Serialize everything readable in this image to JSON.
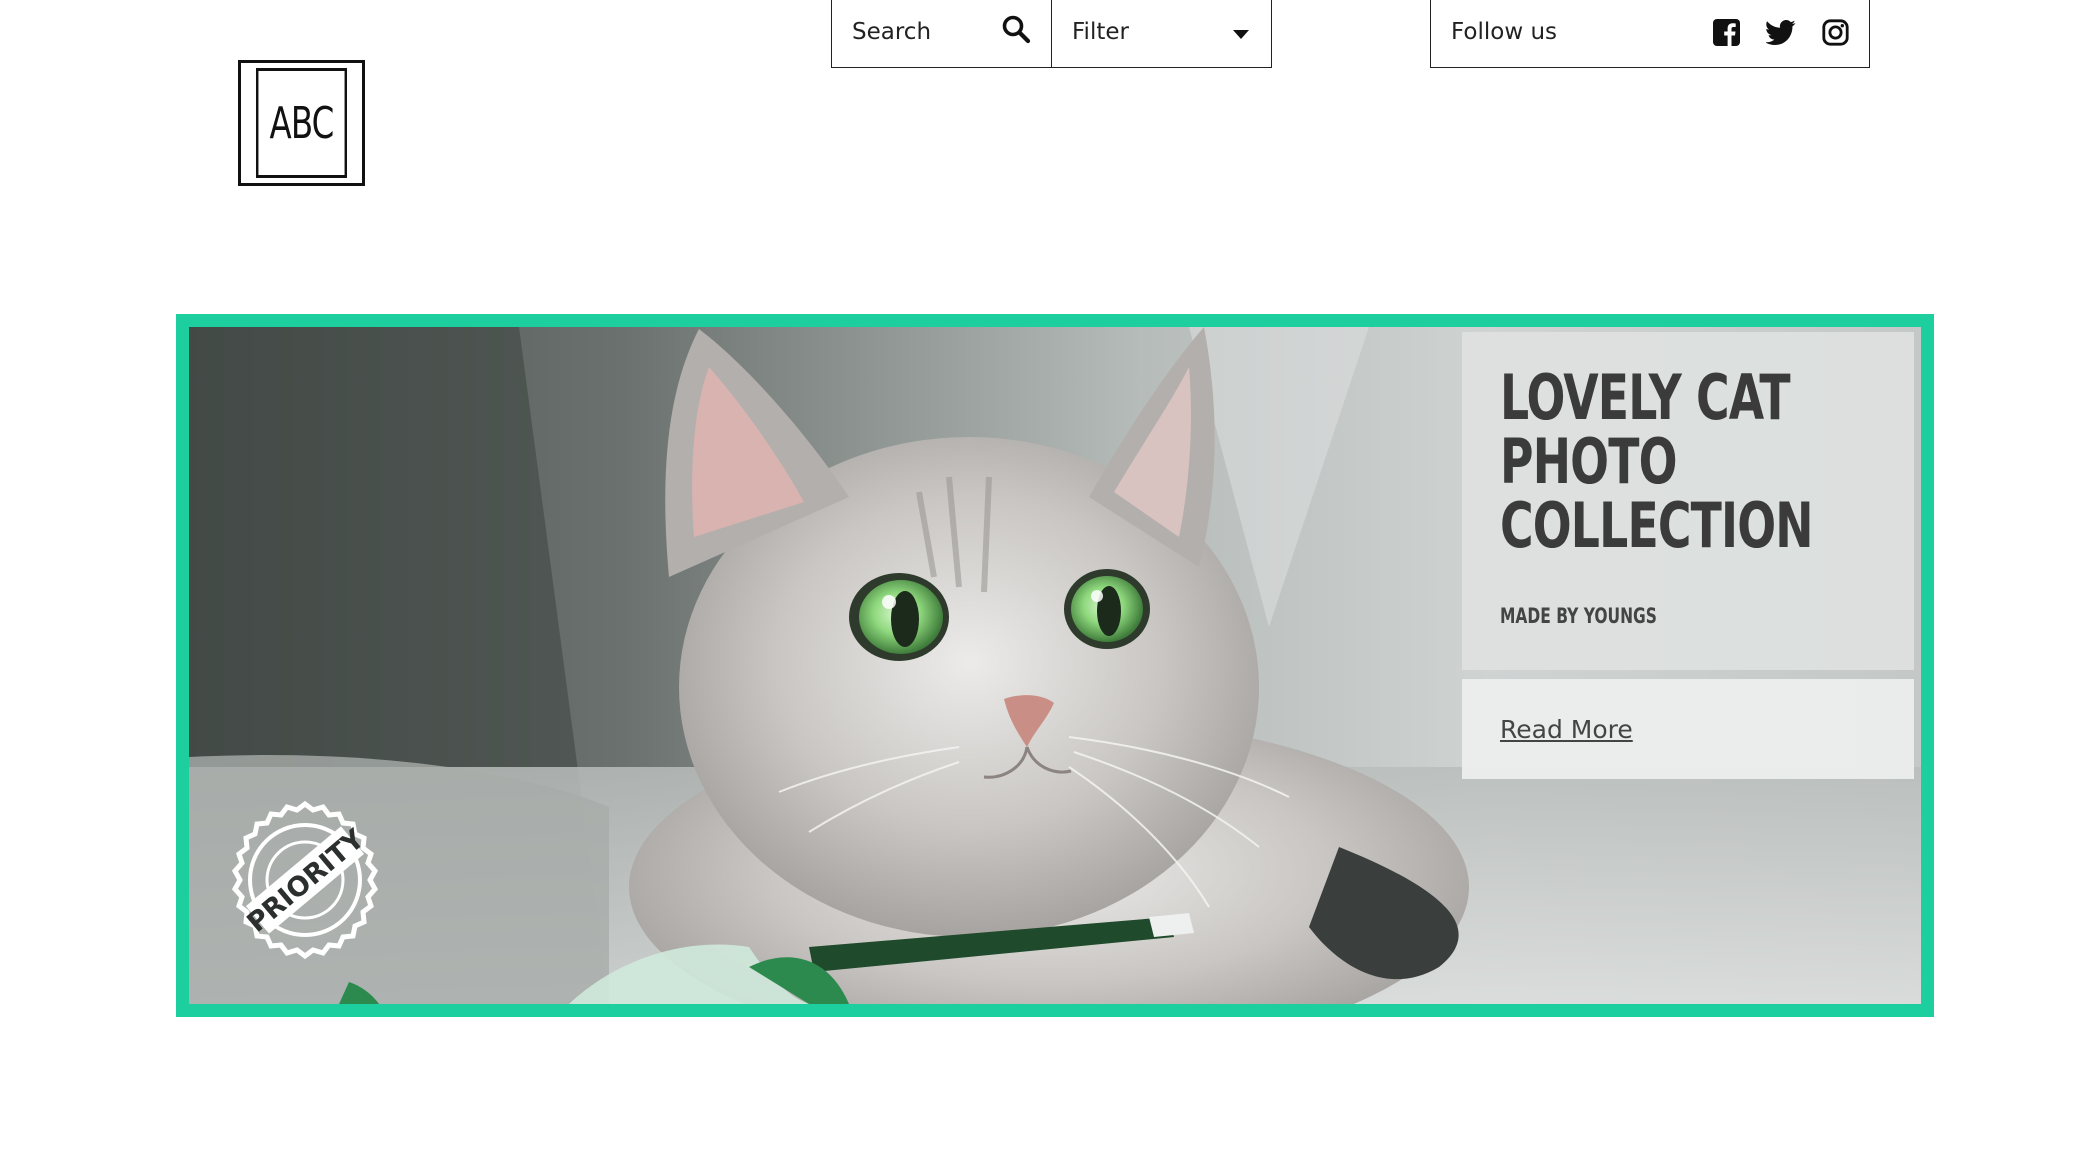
{
  "logo": {
    "text": "ABC"
  },
  "search": {
    "label": "Search",
    "icon": "search-icon"
  },
  "filter": {
    "label": "Filter",
    "icon": "caret-down-icon"
  },
  "follow": {
    "label": "Follow us",
    "icons": [
      "facebook-icon",
      "twitter-icon",
      "instagram-icon"
    ]
  },
  "hero": {
    "title": "LOVELY CAT PHOTO COLLECTION",
    "subtitle": "MADE BY YOUNGS",
    "read_more": "Read More",
    "stamp_text": "PRIORITY",
    "accent_color": "#1dcf9f"
  }
}
